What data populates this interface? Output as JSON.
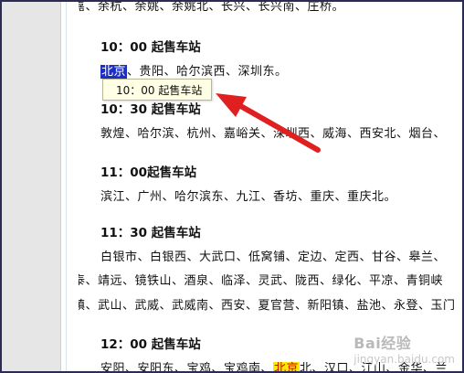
{
  "doc": {
    "line0": "嘉、余杭、余姚、余姚北、长兴、长兴南、庄桥。",
    "h1": "10：00 起售车站",
    "line1_sel": "北京",
    "line1_rest": "、贵阳、哈尔滨西、深圳东。",
    "h2": "10：30 起售车站",
    "line2": "敦煌、哈尔滨、杭州、嘉峪关、深圳西、威海、西安北、烟台、",
    "h3": "11：00起售车站",
    "line3": "滨江、广州、哈尔滨东、九江、香坊、重庆、重庆北。",
    "h4": "11：30 起售车站",
    "line4a": "白银市、白银西、大武口、低窝铺、定边、定西、甘谷、皋兰、",
    "line4b": "泰、靖远、镜铁山、酒泉、临泽、灵武、陇西、绿化、平凉、青铜峡",
    "line4c": "镇、武山、武威、武威南、西安、夏官营、新阳镇、盐池、永登、玉门",
    "h5": "12：00 起售车站",
    "line5_pre": "安阳、安阳东、宝鸡、宝鸡南、",
    "line5_hl": "北京",
    "line5_post": "北、汉口、江山、金华、兰"
  },
  "tooltip": {
    "text": "10：00 起售车站"
  },
  "watermark": {
    "logo": "Bai经验",
    "sub": "jingyan.baidu.com"
  },
  "colors": {
    "arrow": "#e02020",
    "selection": "#1c2fbf",
    "highlight": "#ffe600"
  }
}
